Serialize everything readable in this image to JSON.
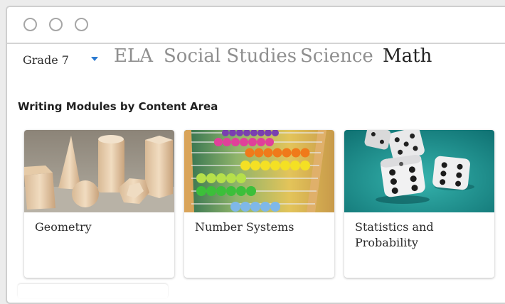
{
  "window": {
    "controls": [
      "window-close-dot",
      "window-minimize-dot",
      "window-maximize-dot"
    ]
  },
  "filter": {
    "grade_label": "Grade 7",
    "caret_icon": "chevron-down-icon",
    "accent_color": "#2a7ad1"
  },
  "subjects": [
    {
      "label": "ELA",
      "active": false
    },
    {
      "label": "Social Studies",
      "active": false
    },
    {
      "label": "Science",
      "active": false
    },
    {
      "label": "Math",
      "active": true
    }
  ],
  "section": {
    "heading": "Writing Modules by Content Area"
  },
  "cards": [
    {
      "title": "Geometry",
      "image": "geometric-solids-image"
    },
    {
      "title": "Number Systems",
      "image": "abacus-image"
    },
    {
      "title": "Statistics and Probability",
      "image": "dice-image"
    }
  ]
}
